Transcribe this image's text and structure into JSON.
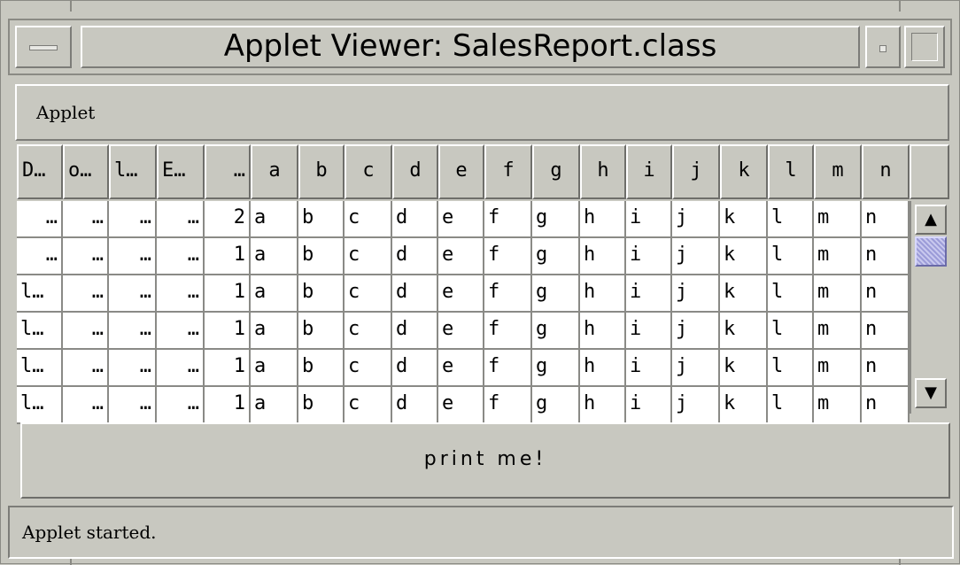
{
  "window": {
    "title": "Applet Viewer: SalesReport.class"
  },
  "menubar": {
    "applet_label": "Applet"
  },
  "table": {
    "headers": [
      "D…",
      "o…",
      "l…",
      "E…",
      "…",
      "a",
      "b",
      "c",
      "d",
      "e",
      "f",
      "g",
      "h",
      "i",
      "j",
      "k",
      "l",
      "m",
      "n"
    ],
    "rows": [
      [
        "…",
        "…",
        "…",
        "…",
        "2",
        "a",
        "b",
        "c",
        "d",
        "e",
        "f",
        "g",
        "h",
        "i",
        "j",
        "k",
        "l",
        "m",
        "n"
      ],
      [
        "…",
        "…",
        "…",
        "…",
        "1",
        "a",
        "b",
        "c",
        "d",
        "e",
        "f",
        "g",
        "h",
        "i",
        "j",
        "k",
        "l",
        "m",
        "n"
      ],
      [
        "l…",
        "…",
        "…",
        "…",
        "1",
        "a",
        "b",
        "c",
        "d",
        "e",
        "f",
        "g",
        "h",
        "i",
        "j",
        "k",
        "l",
        "m",
        "n"
      ],
      [
        "l…",
        "…",
        "…",
        "…",
        "1",
        "a",
        "b",
        "c",
        "d",
        "e",
        "f",
        "g",
        "h",
        "i",
        "j",
        "k",
        "l",
        "m",
        "n"
      ],
      [
        "l…",
        "…",
        "…",
        "…",
        "1",
        "a",
        "b",
        "c",
        "d",
        "e",
        "f",
        "g",
        "h",
        "i",
        "j",
        "k",
        "l",
        "m",
        "n"
      ],
      [
        "l…",
        "…",
        "…",
        "…",
        "1",
        "a",
        "b",
        "c",
        "d",
        "e",
        "f",
        "g",
        "h",
        "i",
        "j",
        "k",
        "l",
        "m",
        "n"
      ]
    ],
    "scroll_up_icon": "▲",
    "scroll_down_icon": "▼"
  },
  "print_button": {
    "label": "print me!"
  },
  "status": {
    "text": "Applet started."
  }
}
